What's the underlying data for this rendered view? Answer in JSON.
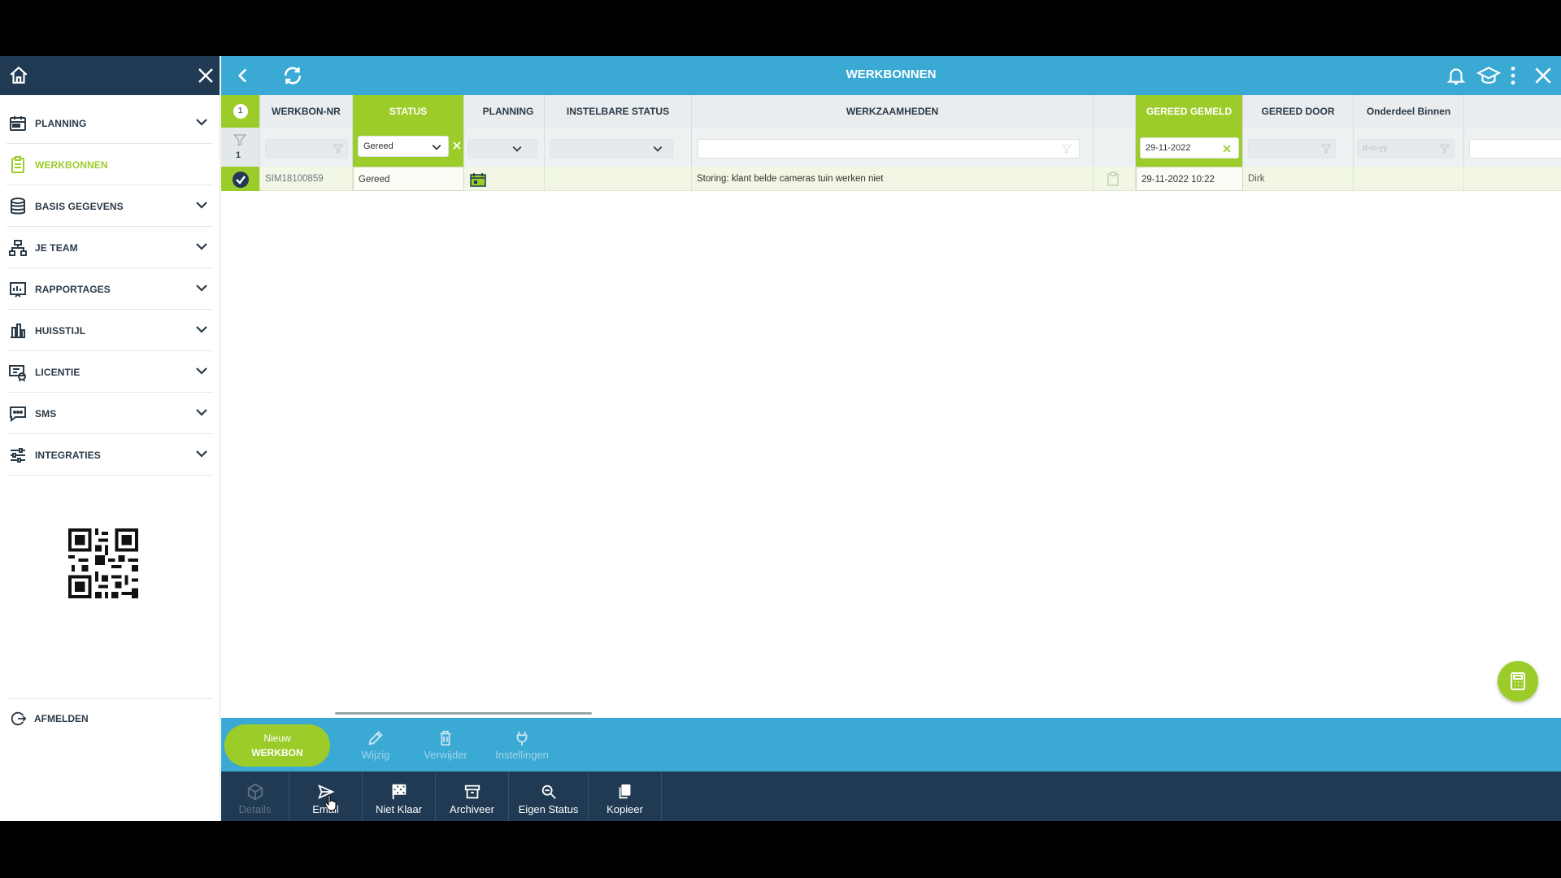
{
  "sidebar": {
    "items": [
      {
        "label": "PLANNING",
        "icon": "calendar-icon",
        "active": false,
        "expandable": true
      },
      {
        "label": "WERKBONNEN",
        "icon": "clipboard-icon",
        "active": true,
        "expandable": false
      },
      {
        "label": "BASIS GEGEVENS",
        "icon": "database-icon",
        "active": false,
        "expandable": true
      },
      {
        "label": "JE TEAM",
        "icon": "team-hierarchy-icon",
        "active": false,
        "expandable": true
      },
      {
        "label": "RAPPORTAGES",
        "icon": "report-icon",
        "active": false,
        "expandable": true
      },
      {
        "label": "HUISSTIJL",
        "icon": "brand-style-icon",
        "active": false,
        "expandable": true
      },
      {
        "label": "LICENTIE",
        "icon": "license-icon",
        "active": false,
        "expandable": true
      },
      {
        "label": "SMS",
        "icon": "sms-icon",
        "active": false,
        "expandable": true
      },
      {
        "label": "INTEGRATIES",
        "icon": "sliders-icon",
        "active": false,
        "expandable": true
      }
    ],
    "logout_label": "AFMELDEN"
  },
  "header": {
    "title": "WERKBONNEN"
  },
  "grid": {
    "selected_count": "1",
    "filter_count": "1",
    "columns": {
      "werkbon_nr": "WERKBON-NR",
      "status": "STATUS",
      "planning": "PLANNING",
      "instelbare_status": "INSTELBARE STATUS",
      "werkzaamheden": "WERKZAAMHEDEN",
      "gereed_gemeld": "GEREED GEMELD",
      "gereed_door": "GEREED DOOR",
      "onderdeel_binnen": "Onderdeel Binnen"
    },
    "filters": {
      "status_value": "Gereed",
      "gereed_gemeld_value": "29-11-2022",
      "onderdeel_placeholder": "d-m-yy"
    },
    "rows": [
      {
        "werkbon_nr": "SIM18100859",
        "status": "Gereed",
        "werkzaamheden": "Storing: klant belde cameras tuin werken niet",
        "gereed_gemeld": "29-11-2022 10:22",
        "gereed_door": "Dirk"
      }
    ]
  },
  "toolbar": {
    "new_line1": "Nieuw",
    "new_line2": "WERKBON",
    "edit": "Wijzig",
    "delete": "Verwijder",
    "settings": "Instellingen"
  },
  "bottombar": {
    "details": "Details",
    "email": "Email",
    "niet_klaar": "Niet Klaar",
    "archiveer": "Archiveer",
    "eigen_status": "Eigen Status",
    "kopieer": "Kopieer"
  },
  "colors": {
    "accent_green": "#9ccc29",
    "topbar_blue": "#3aa9d4",
    "dark_navy": "#1f3a52"
  }
}
